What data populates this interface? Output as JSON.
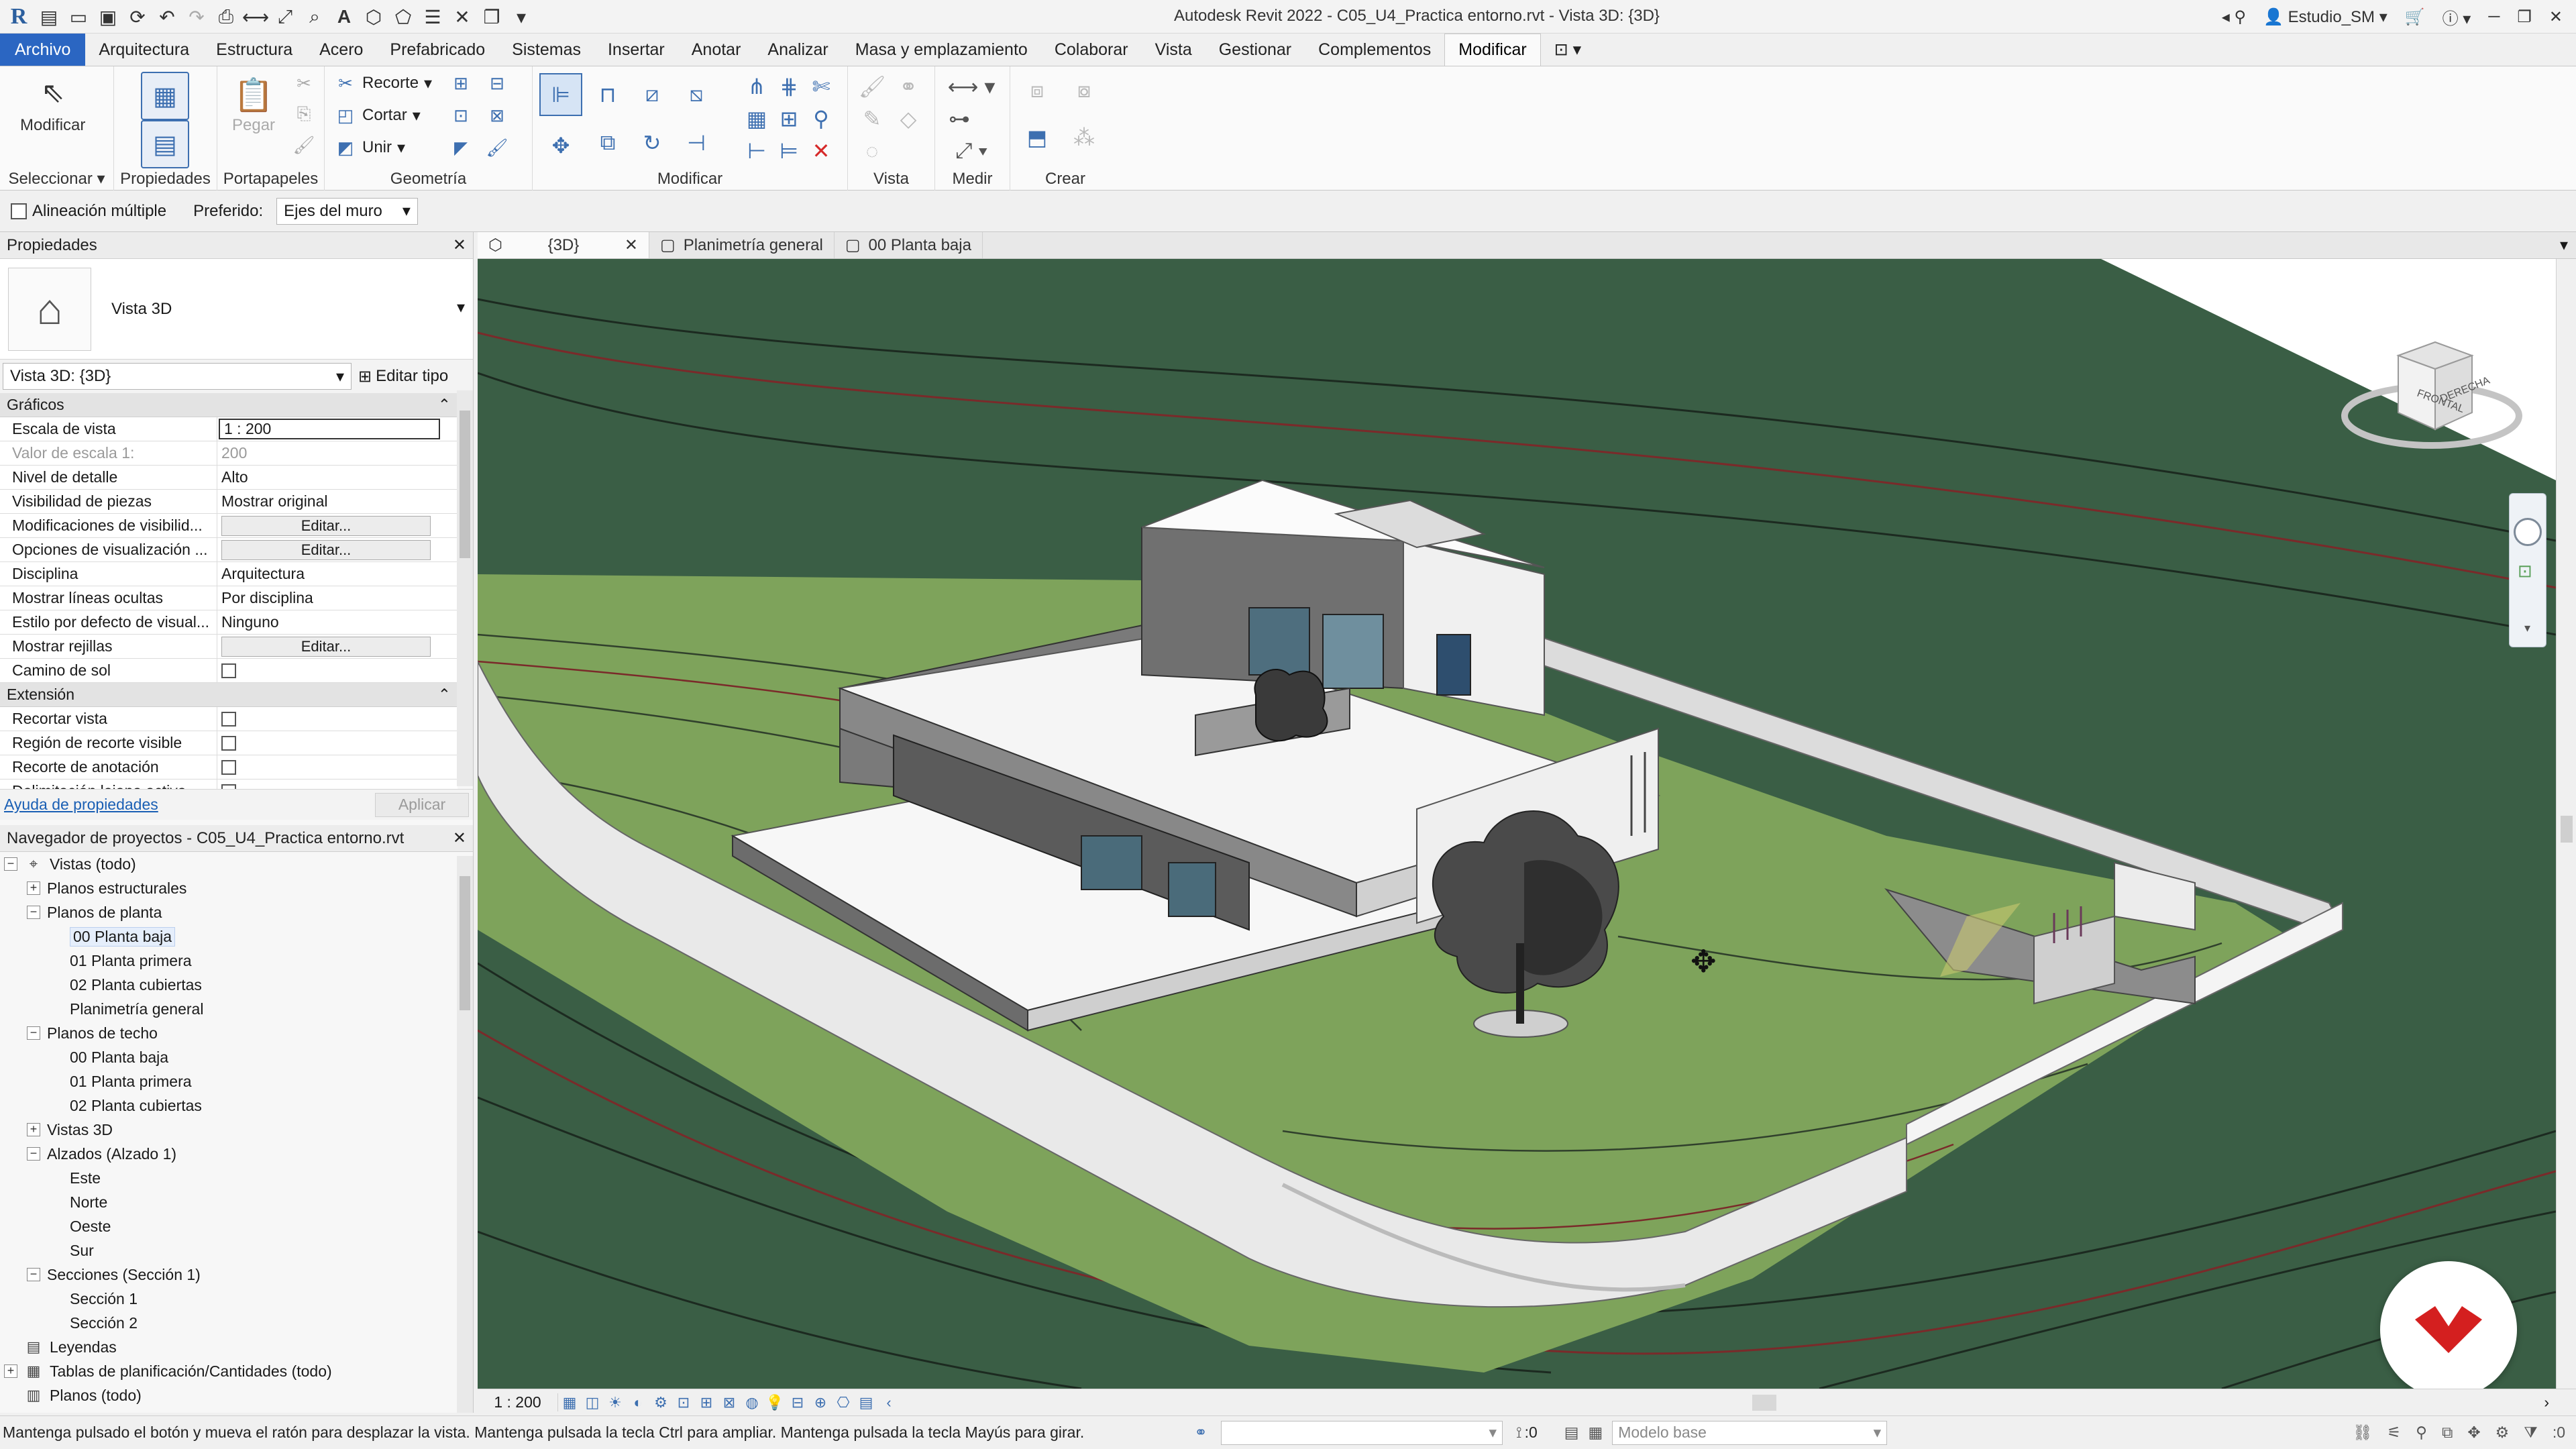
{
  "window": {
    "title": "Autodesk Revit 2022 - C05_U4_Practica entorno.rvt - Vista 3D: {3D}",
    "user": "Estudio_SM"
  },
  "ribbon": {
    "tabs": [
      "Archivo",
      "Arquitectura",
      "Estructura",
      "Acero",
      "Prefabricado",
      "Sistemas",
      "Insertar",
      "Anotar",
      "Analizar",
      "Masa y emplazamiento",
      "Colaborar",
      "Vista",
      "Gestionar",
      "Complementos",
      "Modificar"
    ],
    "active_tab": "Modificar",
    "panels": {
      "select": {
        "button": "Modificar",
        "label": "Seleccionar"
      },
      "properties": {
        "label": "Propiedades"
      },
      "clipboard": {
        "button": "Pegar",
        "label": "Portapapeles"
      },
      "geometry": {
        "items": [
          "Recorte",
          "Cortar",
          "Unir"
        ],
        "label": "Geometría"
      },
      "modify": {
        "label": "Modificar"
      },
      "view": {
        "label": "Vista"
      },
      "measure": {
        "label": "Medir"
      },
      "create": {
        "label": "Crear"
      }
    }
  },
  "options_bar": {
    "multi_align_label": "Alineación múltiple",
    "preferred_label": "Preferido:",
    "preferred_value": "Ejes del muro"
  },
  "properties": {
    "title": "Propiedades",
    "type_name": "Vista 3D",
    "selector": "Vista 3D: {3D}",
    "edit_type": "Editar tipo",
    "groups": [
      {
        "name": "Gráficos",
        "rows": [
          {
            "k": "Escala de vista",
            "v": "1 : 200"
          },
          {
            "k": "Valor de escala    1:",
            "v": "200"
          },
          {
            "k": "Nivel de detalle",
            "v": "Alto"
          },
          {
            "k": "Visibilidad de piezas",
            "v": "Mostrar original"
          },
          {
            "k": "Modificaciones de visibilid...",
            "v": "Editar..."
          },
          {
            "k": "Opciones de visualización ...",
            "v": "Editar..."
          },
          {
            "k": "Disciplina",
            "v": "Arquitectura"
          },
          {
            "k": "Mostrar líneas ocultas",
            "v": "Por disciplina"
          },
          {
            "k": "Estilo por defecto de visual...",
            "v": "Ninguno"
          },
          {
            "k": "Mostrar rejillas",
            "v": "Editar..."
          },
          {
            "k": "Camino de sol",
            "v": ""
          }
        ]
      },
      {
        "name": "Extensión",
        "rows": [
          {
            "k": "Recortar vista",
            "v": ""
          },
          {
            "k": "Región de recorte visible",
            "v": ""
          },
          {
            "k": "Recorte de anotación",
            "v": ""
          },
          {
            "k": "Delimitación lejana activa",
            "v": ""
          }
        ]
      }
    ],
    "help_link": "Ayuda de propiedades",
    "apply": "Aplicar"
  },
  "browser": {
    "title": "Navegador de proyectos - C05_U4_Practica entorno.rvt",
    "items": [
      {
        "level": 0,
        "label": "Vistas (todo)",
        "exp": "−",
        "icon": "views"
      },
      {
        "level": 1,
        "label": "Planos estructurales",
        "exp": "+"
      },
      {
        "level": 1,
        "label": "Planos de planta",
        "exp": "−"
      },
      {
        "level": 2,
        "label": "00 Planta baja",
        "selected": true
      },
      {
        "level": 2,
        "label": "01 Planta primera"
      },
      {
        "level": 2,
        "label": "02 Planta cubiertas"
      },
      {
        "level": 2,
        "label": "Planimetría general"
      },
      {
        "level": 1,
        "label": "Planos de techo",
        "exp": "−"
      },
      {
        "level": 2,
        "label": "00 Planta baja"
      },
      {
        "level": 2,
        "label": "01 Planta primera"
      },
      {
        "level": 2,
        "label": "02 Planta cubiertas"
      },
      {
        "level": 1,
        "label": "Vistas 3D",
        "exp": "+"
      },
      {
        "level": 1,
        "label": "Alzados (Alzado 1)",
        "exp": "−"
      },
      {
        "level": 2,
        "label": "Este"
      },
      {
        "level": 2,
        "label": "Norte"
      },
      {
        "level": 2,
        "label": "Oeste"
      },
      {
        "level": 2,
        "label": "Sur"
      },
      {
        "level": 1,
        "label": "Secciones (Sección 1)",
        "exp": "−"
      },
      {
        "level": 2,
        "label": "Sección 1"
      },
      {
        "level": 2,
        "label": "Sección 2"
      },
      {
        "level": 0,
        "label": "Leyendas",
        "icon": "legend"
      },
      {
        "level": 0,
        "label": "Tablas de planificación/Cantidades (todo)",
        "exp": "+",
        "icon": "table"
      },
      {
        "level": 0,
        "label": "Planos (todo)",
        "icon": "sheet"
      }
    ]
  },
  "view_tabs": [
    {
      "label": "{3D}",
      "active": true
    },
    {
      "label": "Planimetría general"
    },
    {
      "label": "00 Planta baja"
    }
  ],
  "viewcube": {
    "front": "FRONTAL",
    "right": "DERECHA"
  },
  "view_control": {
    "scale": "1 : 200"
  },
  "status": {
    "text": "Mantenga pulsado el botón y mueva el ratón para desplazar la vista. Mantenga pulsada la tecla Ctrl para ampliar. Mantenga pulsada la tecla Mayús para girar.",
    "coord": ":0",
    "model": "Modelo base",
    "filter": ":0"
  },
  "colors": {
    "ribbon_file": "#2b66c2",
    "terrain_dark": "#3a5e45",
    "terrain_light": "#7fa05a",
    "brand_red": "#d41f1f"
  }
}
